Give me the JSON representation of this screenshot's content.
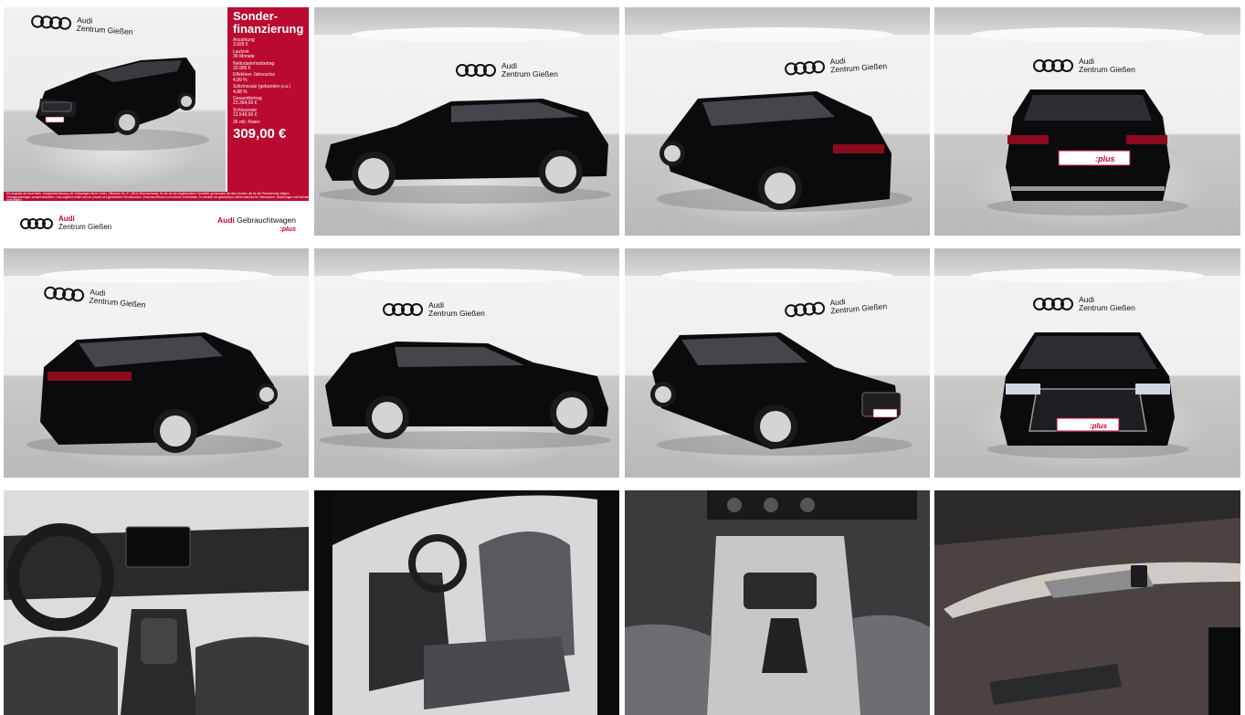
{
  "dealer": {
    "brand": "Audi",
    "name": "Zentrum Gießen"
  },
  "financing": {
    "heading": "Sonder-\nfinanzierung",
    "rows": [
      {
        "label": "Anzahlung",
        "value": "3.925 €"
      },
      {
        "label": "Laufzeit",
        "value": "36 Monate"
      },
      {
        "label": "Nettodarlehnsbetrag",
        "value": "20.905 €"
      },
      {
        "label": "Effektiver Jahreszins",
        "value": "4,99 %"
      },
      {
        "label": "Sollzinssatz (gebunden p.a.)",
        "value": "4,88 %"
      },
      {
        "label": "Gesamtbetrag",
        "value": "23.364,06 €"
      },
      {
        "label": "Schlussrate",
        "value": "12.549,06 €"
      }
    ],
    "rate_label": "36 mtl. Raten",
    "rate_value": "309,00 €",
    "disclaimer": "Ein Angebot der Audi Bank, Zweigniederlassung der Volkswagen Bank GmbH, Gifhorner Str. 57, 38112 Braunschweig, für die wir als ungebundener Vermittler gemeinsam mit dem Kunden die für die Finanzierung nötigen Vertragsunterlagen zusammenstellen. Das Angebot richtet sich an private und gewerbliche Einzelkunden. Zwischenverkauf und Irrtümer vorbehalten. Es besteht ein gesetzliches Widerrufsrecht für Verbraucher. Änderungen und Irrtümer vorbehalten.",
    "gw_brand": "Audi",
    "gw_label": "Gebrauchtwagen",
    "gw_plus": ":plus"
  },
  "plate": ":plus",
  "colors": {
    "audi_red": "#bb0a30",
    "car_body": "#0b0b0d"
  }
}
